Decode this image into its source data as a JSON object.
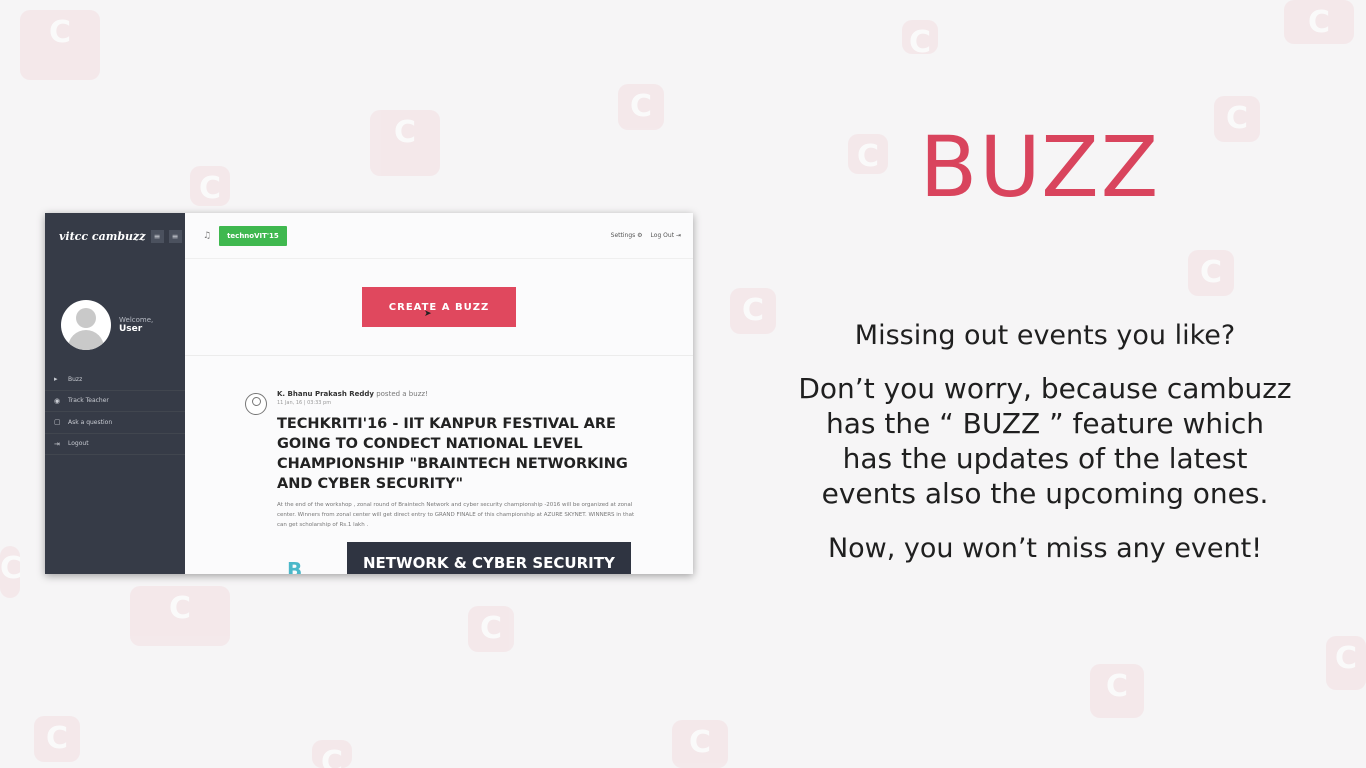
{
  "colors": {
    "accent": "#d9445d",
    "create_button": "#e0485e",
    "sidebar_bg": "#363b47",
    "tag_green": "#3fb84f"
  },
  "slide": {
    "headline": "BUZZ",
    "question": "Missing out events you like?",
    "description_lines": [
      "Don’t you worry, because cambuzz",
      "has the “ BUZZ ” feature which",
      "has the updates of the latest",
      "events also the upcoming ones."
    ],
    "closing": "Now, you won’t miss any event!"
  },
  "app": {
    "brand": "vitcc cambuzz",
    "sidebar": {
      "welcome": "Welcome,",
      "user": "User",
      "items": [
        {
          "label": "Buzz",
          "icon": "megaphone-icon"
        },
        {
          "label": "Track Teacher",
          "icon": "eye-icon"
        },
        {
          "label": "Ask a question",
          "icon": "question-icon"
        },
        {
          "label": "Logout",
          "icon": "logout-icon"
        }
      ]
    },
    "topbar": {
      "tag": "technoVIT'15",
      "settings": "Settings",
      "logout": "Log Out"
    },
    "create_button": "CREATE A BUZZ",
    "post": {
      "author": "K. Bhanu Prakash Reddy",
      "verb": "posted a buzz!",
      "time": "11 Jan, 16 | 03:33 pm",
      "title": "TECHKRITI'16 - IIT KANPUR FESTIVAL ARE GOING TO CONDECT NATIONAL LEVEL CHAMPIONSHIP \"BRAINTECH NETWORKING AND CYBER SECURITY\"",
      "body": "At the end of the workshop , zonal round of Braintech Network and cyber security championship -2016 will be organized at zonal center. Winners from zonal center will get direct entry to GRAND FINALE of this championship at AZURE SKYNET. WINNERS in that can get scholarship of Rs.1 lakh .",
      "image_letter": "B",
      "image_banner": "NETWORK & CYBER SECURITY"
    }
  }
}
